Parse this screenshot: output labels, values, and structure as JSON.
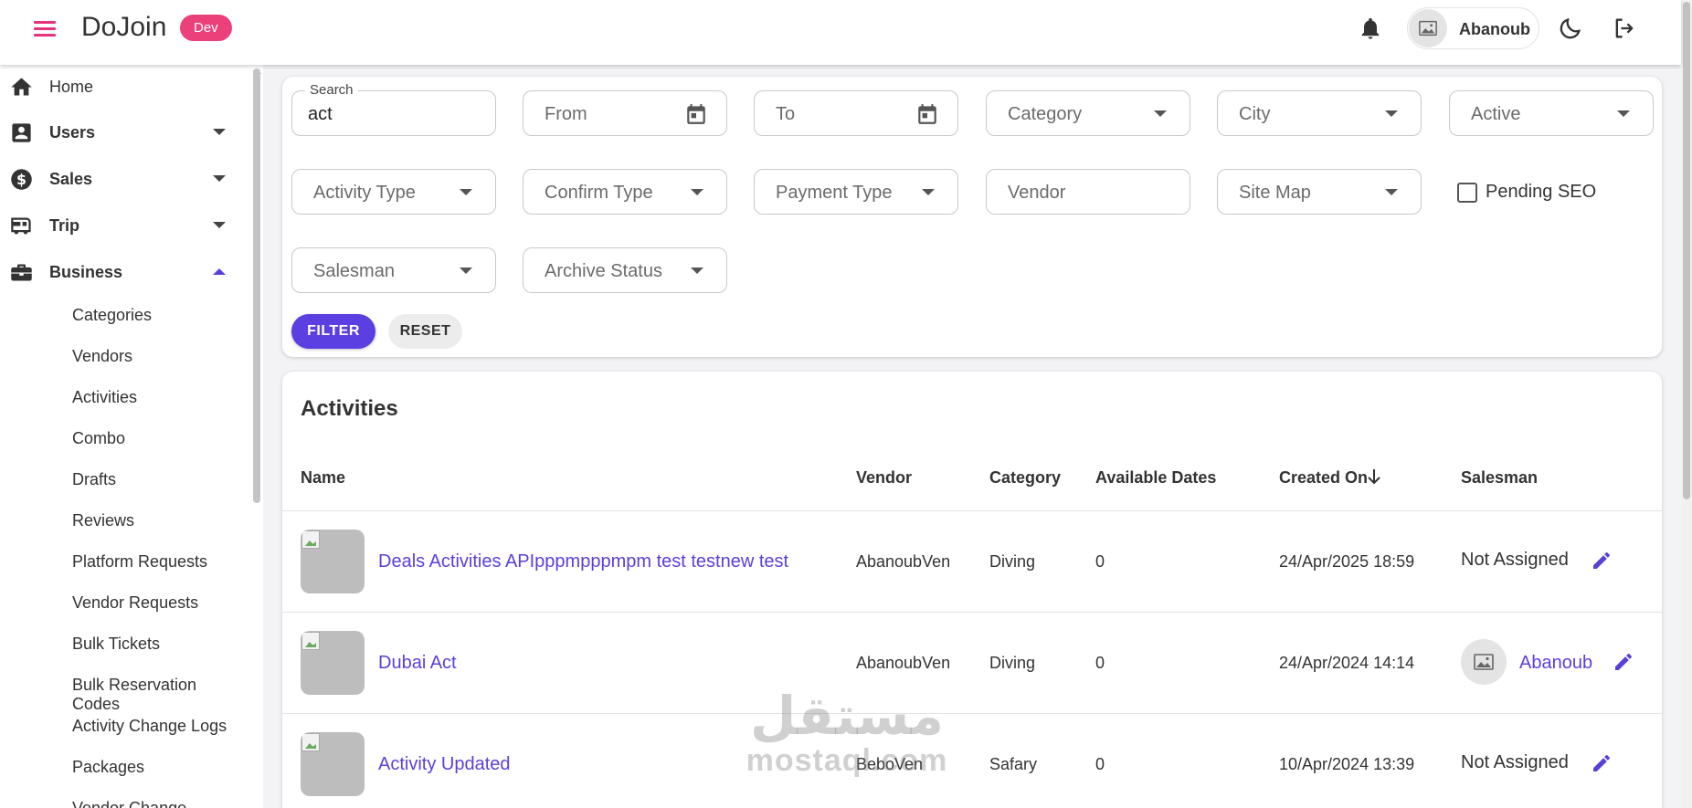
{
  "header": {
    "brand": "DoJoin",
    "env_badge": "Dev",
    "user_name": "Abanoub",
    "icons": [
      "menu-icon",
      "bell-icon",
      "image-placeholder-icon",
      "moon-icon",
      "logout-icon"
    ]
  },
  "sidebar": {
    "items": [
      {
        "label": "Home",
        "icon": "home-icon"
      },
      {
        "label": "Users",
        "icon": "account-box-icon",
        "expanded": false
      },
      {
        "label": "Sales",
        "icon": "dollar-circle-icon",
        "expanded": false
      },
      {
        "label": "Trip",
        "icon": "bus-icon",
        "expanded": false
      },
      {
        "label": "Business",
        "icon": "briefcase-icon",
        "expanded": true
      }
    ],
    "business_children": [
      "Categories",
      "Vendors",
      "Activities",
      "Combo",
      "Drafts",
      "Reviews",
      "Platform Requests",
      "Vendor Requests",
      "Bulk Tickets",
      "Bulk Reservation Codes",
      "Activity Change Logs",
      "Packages",
      "Vendor Change"
    ]
  },
  "filters": {
    "search_label": "Search",
    "search_value": "act",
    "from_placeholder": "From",
    "to_placeholder": "To",
    "category_placeholder": "Category",
    "city_placeholder": "City",
    "active_placeholder": "Active",
    "activity_type_placeholder": "Activity Type",
    "confirm_type_placeholder": "Confirm Type",
    "payment_type_placeholder": "Payment Type",
    "vendor_placeholder": "Vendor",
    "site_map_placeholder": "Site Map",
    "pending_seo_label": "Pending SEO",
    "pending_seo_checked": false,
    "salesman_placeholder": "Salesman",
    "archive_status_placeholder": "Archive Status",
    "filter_button": "FILTER",
    "reset_button": "RESET"
  },
  "table": {
    "title": "Activities",
    "columns": [
      "Name",
      "Vendor",
      "Category",
      "Available Dates",
      "Created On",
      "Salesman"
    ],
    "sort_column": "Created On",
    "sort_direction": "descending",
    "rows": [
      {
        "name": "Deals Activities APIpppmpppmpm test testnew test",
        "vendor": "AbanoubVen",
        "category": "Diving",
        "available_dates": "0",
        "created_on": "24/Apr/2025 18:59",
        "salesman": "Not Assigned",
        "salesman_has_avatar": false
      },
      {
        "name": "Dubai Act",
        "vendor": "AbanoubVen",
        "category": "Diving",
        "available_dates": "0",
        "created_on": "24/Apr/2024 14:14",
        "salesman": "Abanoub",
        "salesman_has_avatar": true
      },
      {
        "name": "Activity Updated",
        "vendor": "BeboVen",
        "category": "Safary",
        "available_dates": "0",
        "created_on": "10/Apr/2024 13:39",
        "salesman": "Not Assigned",
        "salesman_has_avatar": false
      }
    ]
  },
  "watermark": {
    "arabic": "مستقل",
    "latin": "mostaql.com"
  },
  "colors": {
    "accent": "#5b3fe0",
    "brand_pink": "#e6327a",
    "dev_badge": "#ec407a",
    "link": "#5b3fd9"
  }
}
